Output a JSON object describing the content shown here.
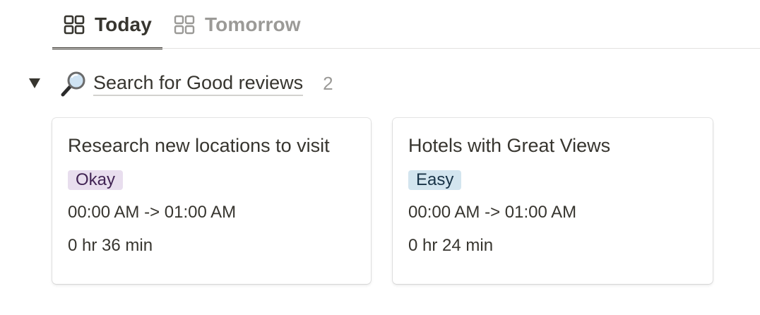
{
  "tabs": [
    {
      "label": "Today",
      "icon": "board-icon",
      "active": true
    },
    {
      "label": "Tomorrow",
      "icon": "board-icon",
      "active": false
    }
  ],
  "group": {
    "emoji": "magnifying-glass-icon",
    "title": "Search for Good reviews",
    "count": "2"
  },
  "cards": [
    {
      "title": "Research new locations to visit",
      "tag": "Okay",
      "time": "00:00 AM -> 01:00 AM",
      "duration": "0 hr 36 min"
    },
    {
      "title": "Hotels with Great Views",
      "tag": "Easy",
      "time": "00:00 AM -> 01:00 AM",
      "duration": "0 hr 24 min"
    }
  ],
  "colors": {
    "text": "#37352f",
    "muted": "#9b9a97",
    "tag_okay_bg": "#e8deee",
    "tag_easy_bg": "#d3e5ef"
  }
}
